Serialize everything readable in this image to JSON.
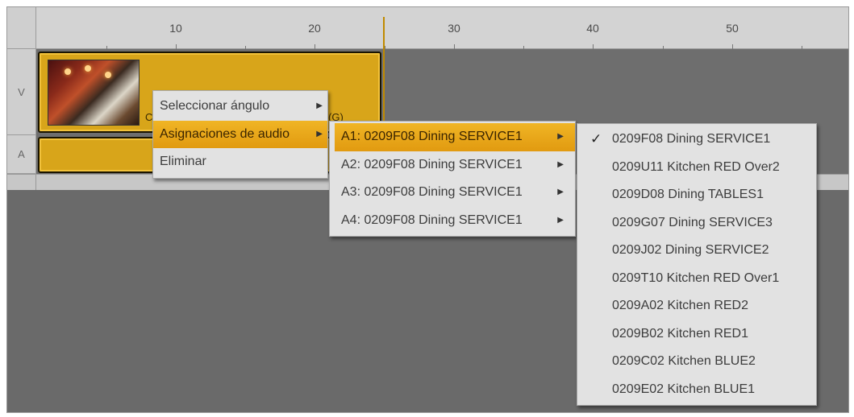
{
  "ruler": {
    "labels": [
      "10",
      "20",
      "30",
      "40",
      "50"
    ]
  },
  "tracks": {
    "video_label": "V",
    "audio_label": "A"
  },
  "clip": {
    "name_fragment_left": "C",
    "name_fragment_right": "(G)"
  },
  "context_menu": {
    "items": [
      {
        "label": "Seleccionar ángulo",
        "submenu": true
      },
      {
        "label": "Asignaciones de audio",
        "submenu": true,
        "highlighted": true
      },
      {
        "label": "Eliminar",
        "submenu": false
      }
    ]
  },
  "audio_menu": {
    "items": [
      {
        "label": "A1: 0209F08 Dining SERVICE1",
        "highlighted": true
      },
      {
        "label": "A2: 0209F08 Dining SERVICE1"
      },
      {
        "label": "A3: 0209F08 Dining SERVICE1"
      },
      {
        "label": "A4: 0209F08 Dining SERVICE1"
      }
    ]
  },
  "source_menu": {
    "checkmark": "✓",
    "items": [
      {
        "label": "0209F08 Dining SERVICE1",
        "checked": true
      },
      {
        "label": "0209U11 Kitchen RED Over2"
      },
      {
        "label": "0209D08 Dining TABLES1"
      },
      {
        "label": "0209G07 Dining SERVICE3"
      },
      {
        "label": "0209J02 Dining SERVICE2"
      },
      {
        "label": "0209T10 Kitchen RED Over1"
      },
      {
        "label": "0209A02 Kitchen RED2"
      },
      {
        "label": "0209B02 Kitchen RED1"
      },
      {
        "label": "0209C02 Kitchen BLUE2"
      },
      {
        "label": "0209E02 Kitchen BLUE1"
      }
    ]
  },
  "colors": {
    "highlight": "#e8a819",
    "clip": "#d8a51a",
    "menu_bg": "#e2e2e2",
    "panel_bg": "#7b7b7b"
  },
  "icons": {
    "submenu": "submenu-arrow-icon",
    "check": "checkmark-icon"
  }
}
